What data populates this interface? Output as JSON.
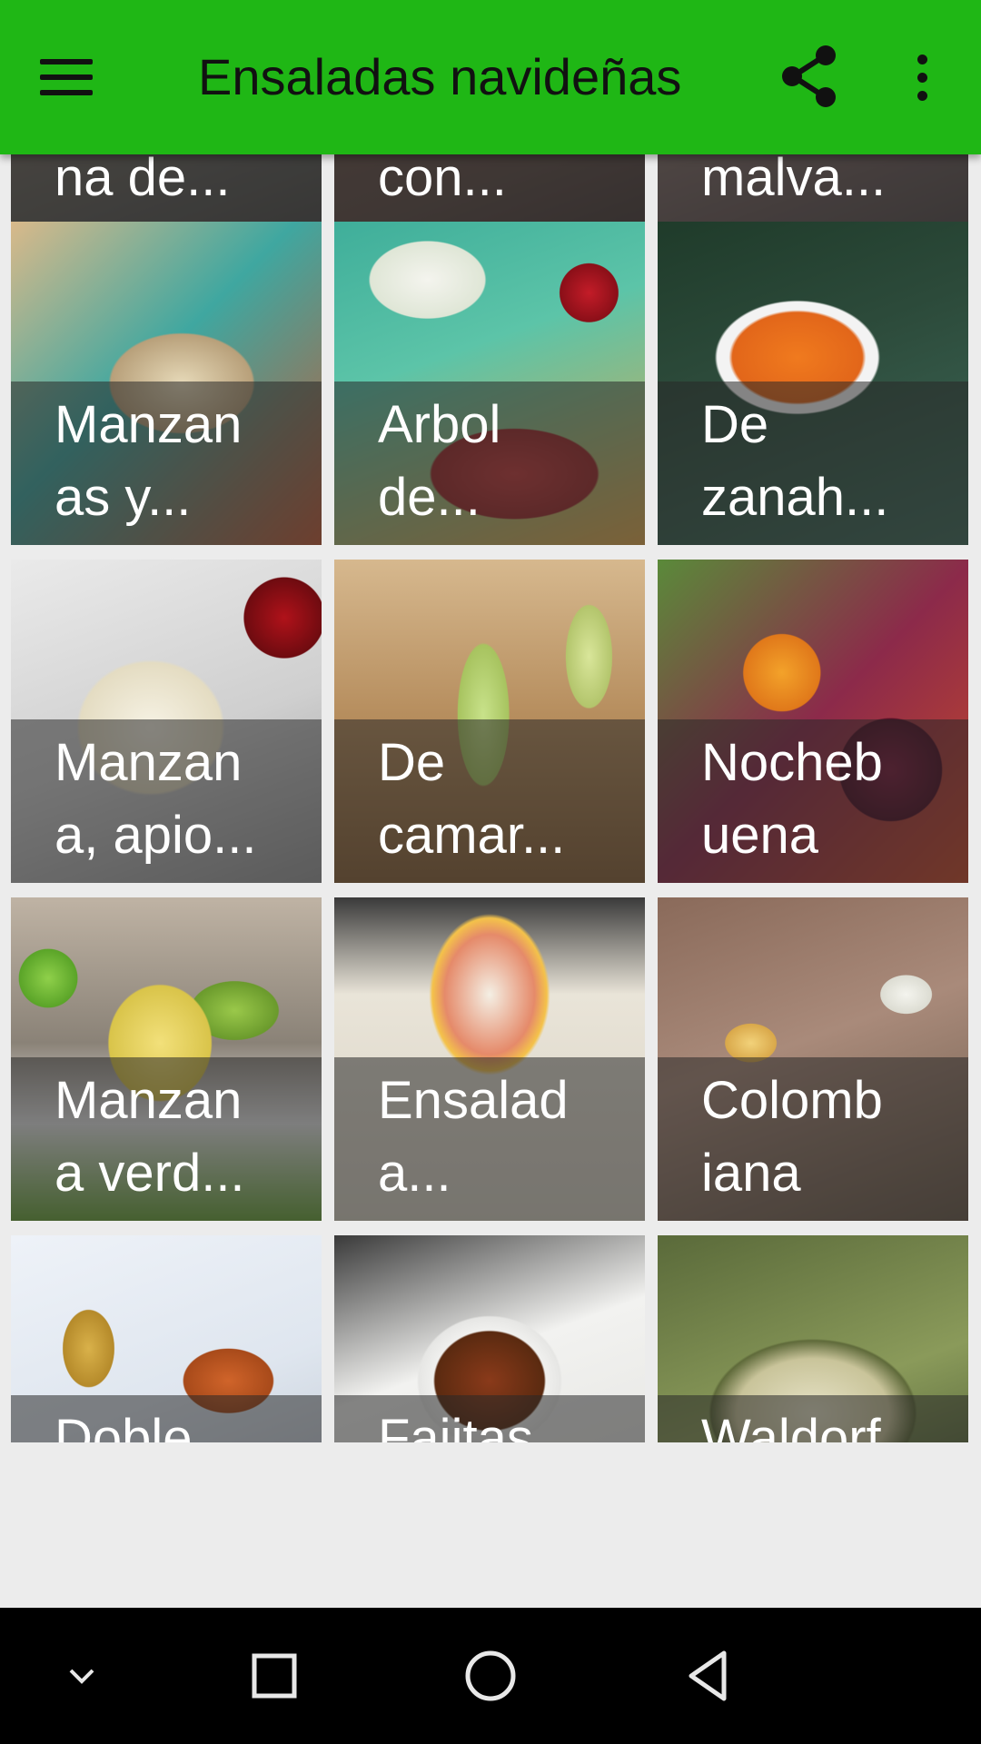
{
  "app_bar": {
    "title": "Ensaladas navideñas",
    "icons": [
      "menu-icon",
      "share-icon",
      "more-vert-icon"
    ],
    "color": "#1fb715"
  },
  "recipes": [
    {
      "label": "na de..."
    },
    {
      "label": "con..."
    },
    {
      "label": "malva..."
    },
    {
      "label": "Manzan\nas y..."
    },
    {
      "label": "Arbol\nde..."
    },
    {
      "label": "De\nzanah..."
    },
    {
      "label": "Manzan\na, apio..."
    },
    {
      "label": "De\ncamar..."
    },
    {
      "label": "Nocheb\nuena"
    },
    {
      "label": "Manzan\na verd..."
    },
    {
      "label": "Ensalad\na..."
    },
    {
      "label": "Colomb\niana"
    },
    {
      "label": "Doble..."
    },
    {
      "label": "Fajitas..."
    },
    {
      "label": "Waldorf..."
    }
  ],
  "nav_bar": {
    "icons": [
      "chevron-down-icon",
      "recents-square-icon",
      "home-circle-icon",
      "back-triangle-icon"
    ]
  }
}
